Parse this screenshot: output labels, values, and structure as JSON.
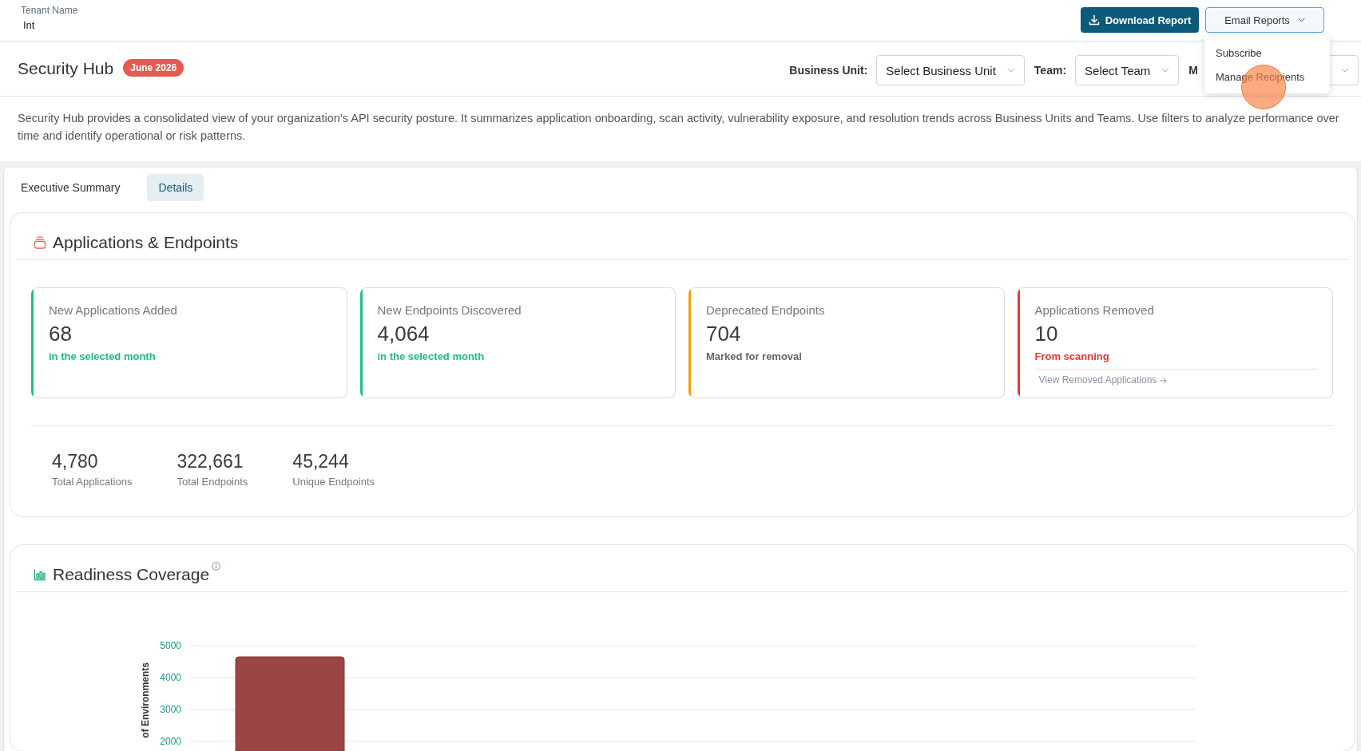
{
  "tenant": {
    "label": "Tenant Name",
    "value": "Int"
  },
  "actions": {
    "download_button": "Download Report",
    "email_button": "Email Reports",
    "email_menu": {
      "open": true,
      "items": [
        {
          "label": "Subscribe",
          "clicked": false
        },
        {
          "label": "Manage Recipients",
          "clicked": true
        }
      ]
    }
  },
  "header": {
    "title": "Security Hub",
    "badge": "June 2026",
    "filters": [
      {
        "label": "Business Unit:",
        "value": "Select Business Unit"
      },
      {
        "label": "Team:",
        "value": "Select Team"
      },
      {
        "label": "M"
      }
    ]
  },
  "description": "Security Hub provides a consolidated view of your organization’s API security posture. It summarizes application onboarding, scan activity, vulnerability exposure, and resolution trends across Business Units and Teams. Use filters to analyze performance over time and identify operational or risk patterns.",
  "tabs": [
    {
      "label": "Executive Summary",
      "selected": false
    },
    {
      "label": "Details",
      "selected": true
    }
  ],
  "applications_endpoints": {
    "title": "Applications & Endpoints",
    "metrics": [
      {
        "label": "New Applications Added",
        "value": "68",
        "color": "#1fbf7d",
        "note": {
          "text": "in the selected month",
          "color": "#1fbf7d"
        }
      },
      {
        "label": "New Endpoints Discovered",
        "value": "4,064",
        "color": "#1fbf7d",
        "note": {
          "text": "in the selected month",
          "color": "#1fbf7d"
        }
      },
      {
        "label": "Deprecated Endpoints",
        "value": "704",
        "color": "#f59e0b",
        "note": {
          "text": "Marked for removal",
          "color": "#666666"
        }
      },
      {
        "label": "Applications Removed",
        "value": "10",
        "color": "#e5393b",
        "note": {
          "text": "From scanning",
          "color": "#e5393b"
        },
        "link": "View Removed Applications"
      }
    ],
    "totals": [
      {
        "value": "4,780",
        "label": "Total Applications"
      },
      {
        "value": "322,661",
        "label": "Total Endpoints"
      },
      {
        "value": "45,244",
        "label": "Unique Endpoints"
      }
    ]
  },
  "readiness_coverage": {
    "title": "Readiness Coverage",
    "chart_data": {
      "type": "bar",
      "ylabel": "of Environments",
      "ylim": [
        1700,
        5000
      ],
      "yticks": [
        2000,
        3000,
        4000,
        5000
      ],
      "grid": true,
      "series": [
        {
          "color": "#9c4545",
          "values": [
            4650
          ]
        }
      ]
    }
  }
}
